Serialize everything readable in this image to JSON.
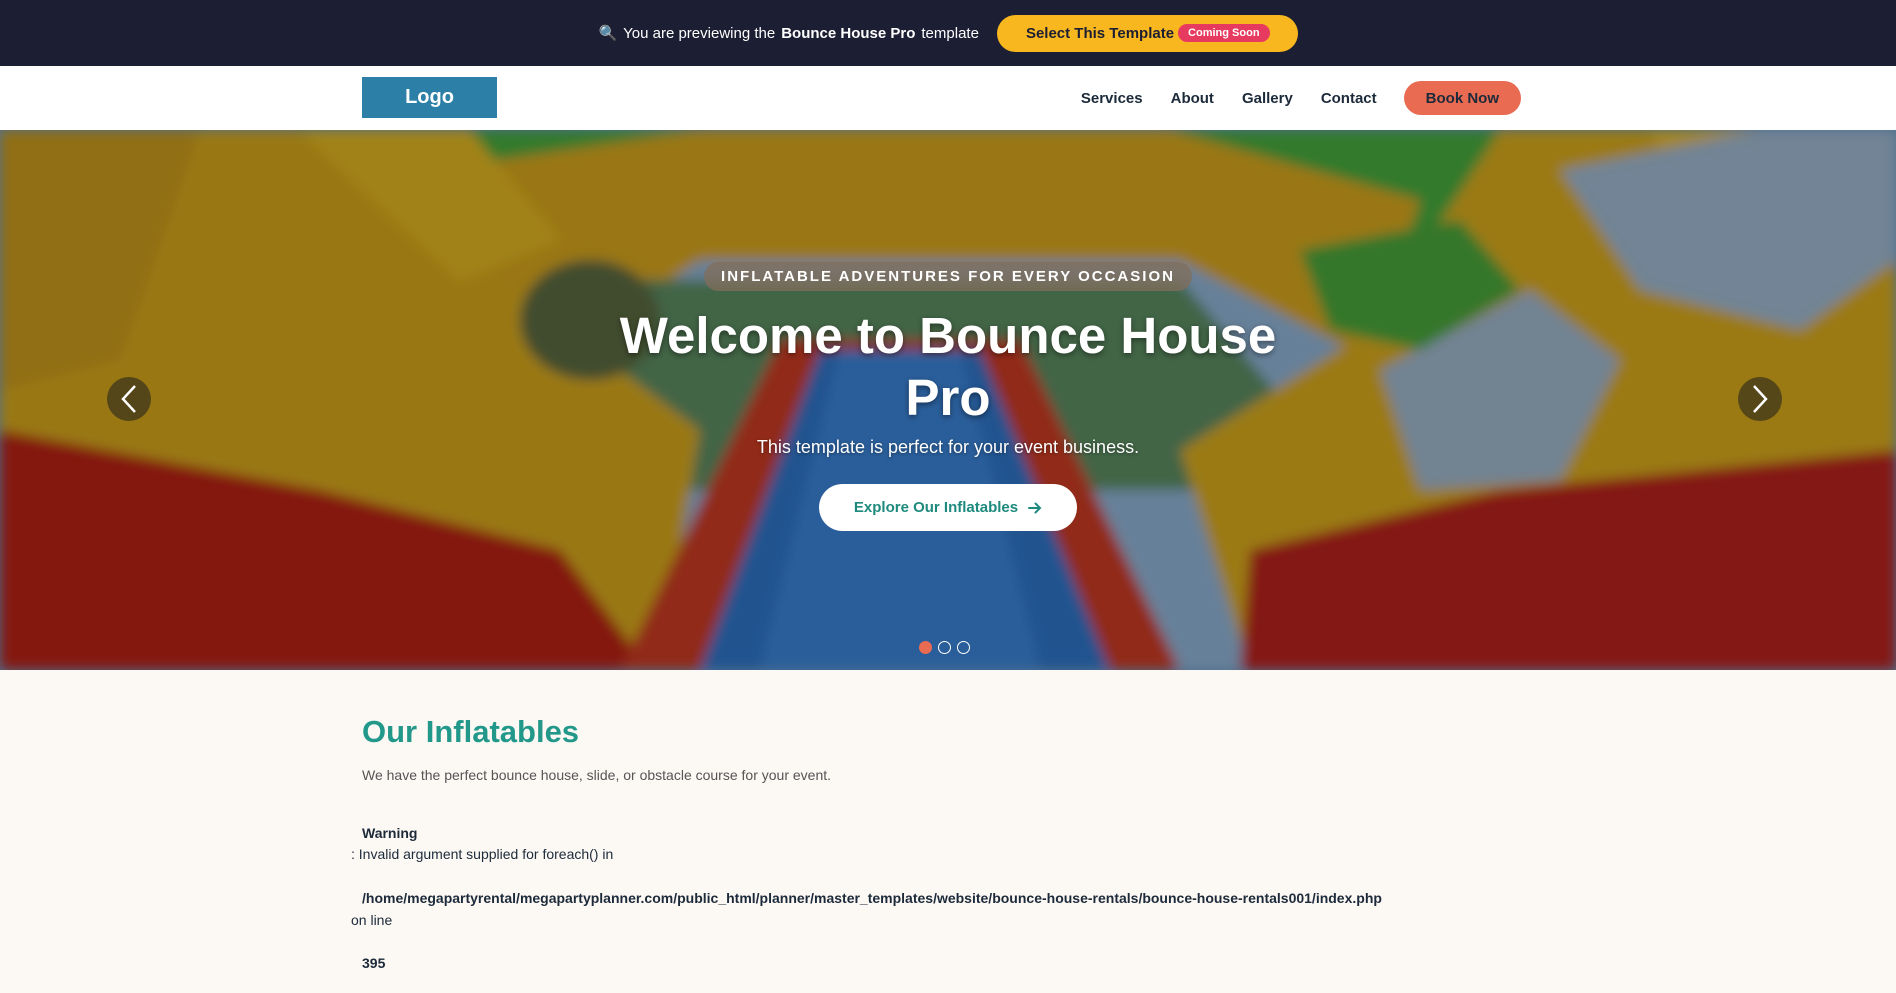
{
  "preview_bar": {
    "prefix": "You are previewing the",
    "template_name": "Bounce House Pro",
    "suffix": "template",
    "select_label": "Select This Template",
    "badge": "Coming Soon",
    "icon": "magnifier-icon"
  },
  "header": {
    "logo": "Logo",
    "nav": [
      "Services",
      "About",
      "Gallery",
      "Contact"
    ],
    "book_label": "Book Now"
  },
  "hero": {
    "eyebrow": "INFLATABLE ADVENTURES FOR EVERY OCCASION",
    "title": "Welcome to Bounce House Pro",
    "subtitle": "This template is perfect for your event business.",
    "cta": "Explore Our Inflatables",
    "slides": 3,
    "active_slide": 1
  },
  "section": {
    "title": "Our Inflatables",
    "description": "We have the perfect bounce house, slide, or obstacle course for your event."
  },
  "warning": {
    "label": "Warning",
    "message": ": Invalid argument supplied for foreach() in",
    "path": "/home/megapartyrental/megapartyplanner.com/public_html/planner/master_templates/website/bounce-house-rentals/bounce-house-rentals001/index.php",
    "on_line": "on line",
    "line": "395"
  },
  "colors": {
    "preview_bg": "#1c1e33",
    "select_btn": "#f9b71f",
    "badge": "#e73a5f",
    "logo_bg": "#2c7fa6",
    "book_btn": "#e96b52",
    "accent_teal": "#22988a"
  }
}
